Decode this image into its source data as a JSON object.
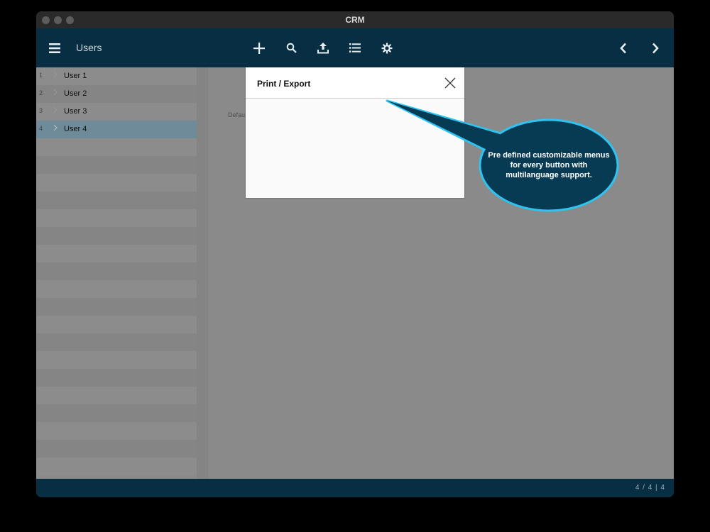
{
  "window": {
    "title": "CRM"
  },
  "toolbar": {
    "title": "Users",
    "icons": [
      "menu-icon",
      "plus-icon",
      "search-icon",
      "upload-icon",
      "list-icon",
      "gear-icon",
      "chevron-left-icon",
      "chevron-right-icon"
    ]
  },
  "sidebar": {
    "items": [
      {
        "num": "1",
        "label": "User 1"
      },
      {
        "num": "2",
        "label": "User 2"
      },
      {
        "num": "3",
        "label": "User 3"
      },
      {
        "num": "4",
        "label": "User 4"
      }
    ],
    "selected_index": 3
  },
  "main": {
    "partial_text": "Defau"
  },
  "dialog": {
    "title": "Print / Export"
  },
  "callout": {
    "text": "Pre defined customizable menus for every button with multilanguage support."
  },
  "statusbar": {
    "page_info": "4 / 4  |  4"
  },
  "colors": {
    "toolbar_bg": "#072e42",
    "selected_row": "#6f8a98",
    "callout_fill": "#073b54",
    "callout_border": "#2ec4f0"
  }
}
